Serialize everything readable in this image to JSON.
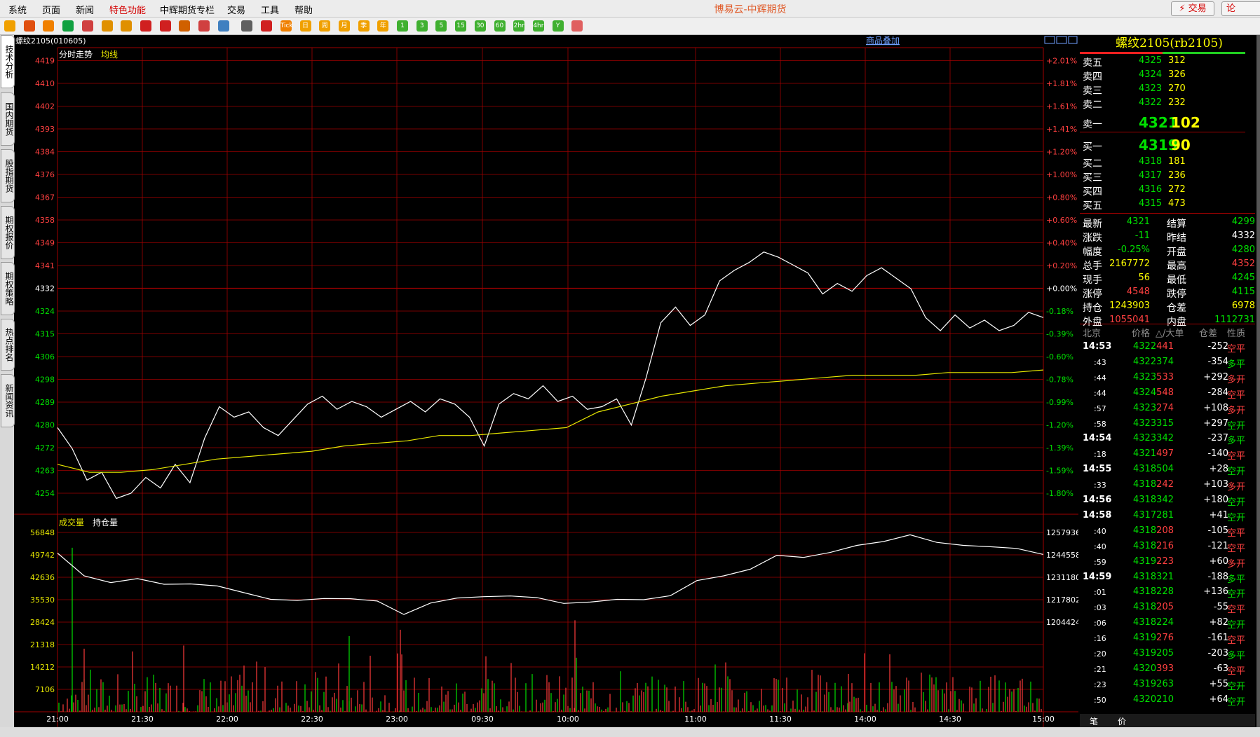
{
  "menubar": {
    "items": [
      "系统",
      "页面",
      "新闻",
      "特色功能",
      "中辉期货专栏",
      "交易",
      "工具",
      "帮助"
    ],
    "highlighted": "特色功能",
    "app_title": "博易云-中辉期货",
    "trade_button": "⚡ 交易",
    "forum_button": "论"
  },
  "toolbar": {
    "icons": [
      "back-icon",
      "home-icon",
      "folder-icon",
      "refresh-icon",
      "window-icon",
      "zoom-in-icon",
      "zoom-out-icon",
      "color-icon",
      "draw-icon",
      "brush-icon",
      "funnel-icon",
      "signal-icon",
      "table-icon",
      "chart-icon",
      "tick-icon",
      "day-icon",
      "week-icon",
      "month-icon",
      "quarter-icon",
      "year-icon",
      "min1-icon",
      "min3-icon",
      "min5-icon",
      "min15-icon",
      "min30-icon",
      "min60-icon",
      "min2h-icon",
      "min4h-icon",
      "custom-icon",
      "calculator-icon"
    ],
    "labels": [
      "",
      "",
      "",
      "",
      "",
      "",
      "",
      "",
      "",
      "",
      "",
      "",
      "",
      "",
      "Tick",
      "日",
      "周",
      "月",
      "季",
      "年",
      "1",
      "3",
      "5",
      "15",
      "30",
      "60",
      "2hr",
      "4hr",
      "Y",
      ""
    ]
  },
  "side_tabs": [
    "技术分析",
    "国内期货",
    "股指期货",
    "期权报价",
    "期权策略",
    "热点排名",
    "新闻资讯"
  ],
  "chart": {
    "contract_label": "螺纹2105(010605)",
    "overlay_button": "商品叠加",
    "price_panel_label": "分时走势",
    "avg_label": "均线",
    "volume_label": "成交量",
    "oi_label": "持仓量",
    "colors": {
      "grid": "#a00000",
      "price": "#ffffff",
      "avg": "#e6e600",
      "up": "#ff3b3b",
      "down": "#00e000",
      "label": "#ff4040",
      "neutral": "#ffffff"
    },
    "price_ticks": [
      "4419",
      "4410",
      "4402",
      "4393",
      "4384",
      "4376",
      "4367",
      "4358",
      "4349",
      "4341",
      "4332",
      "4324",
      "4315",
      "4306",
      "4298",
      "4289",
      "4280",
      "4272",
      "4263",
      "4254"
    ],
    "pct_ticks": [
      "+2.01%",
      "+1.81%",
      "+1.61%",
      "+1.41%",
      "+1.20%",
      "+1.00%",
      "+0.80%",
      "+0.60%",
      "+0.40%",
      "+0.20%",
      "+0.00%",
      "-0.18%",
      "-0.39%",
      "-0.60%",
      "-0.78%",
      "-0.99%",
      "-1.20%",
      "-1.39%",
      "-1.59%",
      "-1.80%"
    ],
    "volume_ticks": [
      "56848",
      "49742",
      "42636",
      "35530",
      "28424",
      "21318",
      "14212",
      "7106"
    ],
    "oi_ticks": [
      "1257936",
      "1244558",
      "1231180",
      "1217802",
      "1204424"
    ],
    "time_ticks": [
      "21:00",
      "21:30",
      "22:00",
      "22:30",
      "23:00",
      "09:30",
      "10:00",
      "11:00",
      "11:30",
      "14:00",
      "14:30",
      "15:00"
    ]
  },
  "chart_data": {
    "type": "line",
    "title": "螺纹2105",
    "price_range": [
      4254,
      4419
    ],
    "pre_settle": 4332,
    "series": [
      {
        "name": "分时走势",
        "values": [
          4279,
          4271,
          4259,
          4262,
          4252,
          4254,
          4260,
          4256,
          4265,
          4258,
          4275,
          4287,
          4283,
          4285,
          4279,
          4276,
          4282,
          4288,
          4291,
          4286,
          4289,
          4287,
          4283,
          4286,
          4289,
          4285,
          4290,
          4288,
          4283,
          4272,
          4288,
          4292,
          4290,
          4295,
          4289,
          4291,
          4286,
          4287,
          4290,
          4280,
          4298,
          4319,
          4325,
          4318,
          4322,
          4335,
          4339,
          4342,
          4346,
          4344,
          4341,
          4338,
          4330,
          4334,
          4331,
          4337,
          4340,
          4336,
          4332,
          4321,
          4316,
          4322,
          4317,
          4320,
          4316,
          4318,
          4323,
          4321
        ]
      },
      {
        "name": "均线",
        "values": [
          4265,
          4262,
          4262,
          4263,
          4265,
          4267,
          4268,
          4269,
          4270,
          4272,
          4273,
          4274,
          4276,
          4276,
          4277,
          4278,
          4279,
          4285,
          4288,
          4291,
          4293,
          4295,
          4296,
          4297,
          4298,
          4299,
          4299,
          4299,
          4300,
          4300,
          4300,
          4301
        ]
      }
    ],
    "oi_range": [
      1204424,
      1257936
    ],
    "oi_values": [
      1245600,
      1232000,
      1228000,
      1230400,
      1227000,
      1227200,
      1226000,
      1222000,
      1218000,
      1217400,
      1218500,
      1218400,
      1217000,
      1209000,
      1215800,
      1218800,
      1219600,
      1220000,
      1219000,
      1215600,
      1216400,
      1218000,
      1217800,
      1220200,
      1229200,
      1232000,
      1236000,
      1244300,
      1243000,
      1246000,
      1250200,
      1252500,
      1256500,
      1252000,
      1250200,
      1249400,
      1248400,
      1244800
    ],
    "volume_range": [
      0,
      56848
    ],
    "volume_note": "成交量 bars shown per minute, mixed red/green"
  },
  "quote": {
    "title": "螺纹2105(rb2105)",
    "asks": [
      {
        "label": "卖五",
        "price": "4325",
        "vol": "312"
      },
      {
        "label": "卖四",
        "price": "4324",
        "vol": "326"
      },
      {
        "label": "卖三",
        "price": "4323",
        "vol": "270"
      },
      {
        "label": "卖二",
        "price": "4322",
        "vol": "232"
      },
      {
        "label": "卖一",
        "price": "4321",
        "vol": "102"
      }
    ],
    "bids": [
      {
        "label": "买一",
        "price": "4319",
        "vol": "90"
      },
      {
        "label": "买二",
        "price": "4318",
        "vol": "181"
      },
      {
        "label": "买三",
        "price": "4317",
        "vol": "236"
      },
      {
        "label": "买四",
        "price": "4316",
        "vol": "272"
      },
      {
        "label": "买五",
        "price": "4315",
        "vol": "473"
      }
    ],
    "stats": [
      {
        "l1": "最新",
        "v1": "4321",
        "c1": "#00e000",
        "l2": "结算",
        "v2": "4299",
        "c2": "#00e000"
      },
      {
        "l1": "涨跌",
        "v1": "-11",
        "c1": "#00e000",
        "l2": "昨结",
        "v2": "4332",
        "c2": "#ffffff"
      },
      {
        "l1": "幅度",
        "v1": "-0.25%",
        "c1": "#00e000",
        "l2": "开盘",
        "v2": "4280",
        "c2": "#00e000"
      },
      {
        "l1": "总手",
        "v1": "2167772",
        "c1": "#ffff00",
        "l2": "最高",
        "v2": "4352",
        "c2": "#ff4040"
      },
      {
        "l1": "现手",
        "v1": "56",
        "c1": "#ffff00",
        "l2": "最低",
        "v2": "4245",
        "c2": "#00e000"
      },
      {
        "l1": "涨停",
        "v1": "4548",
        "c1": "#ff4040",
        "l2": "跌停",
        "v2": "4115",
        "c2": "#00e000"
      },
      {
        "l1": "持仓",
        "v1": "1243903",
        "c1": "#ffff00",
        "l2": "仓差",
        "v2": "6978",
        "c2": "#ffff00"
      },
      {
        "l1": "外盘",
        "v1": "1055041",
        "c1": "#ff4040",
        "l2": "内盘",
        "v2": "1112731",
        "c2": "#00e000"
      }
    ],
    "tick_header": [
      "北京",
      "价格",
      "△/大单",
      "仓差",
      "性质"
    ],
    "ticks": [
      {
        "t": "14:53",
        "p": "4322",
        "v": "441",
        "d": "-252",
        "n": "空平",
        "vc": "#ff4040",
        "nc": "#ff4040"
      },
      {
        "t": ":43",
        "p": "4322",
        "v": "374",
        "d": "-354",
        "n": "多平",
        "vc": "#00e000",
        "nc": "#00e000"
      },
      {
        "t": ":44",
        "p": "4323",
        "v": "533",
        "d": "+292",
        "n": "多开",
        "vc": "#ff4040",
        "nc": "#ff4040"
      },
      {
        "t": ":44",
        "p": "4324",
        "v": "548",
        "d": "-284",
        "n": "空平",
        "vc": "#ff4040",
        "nc": "#ff4040"
      },
      {
        "t": ":57",
        "p": "4323",
        "v": "274",
        "d": "+108",
        "n": "多开",
        "vc": "#ff4040",
        "nc": "#ff4040"
      },
      {
        "t": ":58",
        "p": "4323",
        "v": "315",
        "d": "+297",
        "n": "空开",
        "vc": "#00e000",
        "nc": "#00e000"
      },
      {
        "t": "14:54",
        "p": "4323",
        "v": "342",
        "d": "-237",
        "n": "多平",
        "vc": "#00e000",
        "nc": "#00e000"
      },
      {
        "t": ":18",
        "p": "4321",
        "v": "497",
        "d": "-140",
        "n": "空平",
        "vc": "#ff4040",
        "nc": "#ff4040"
      },
      {
        "t": "14:55",
        "p": "4318",
        "v": "504",
        "d": "+28",
        "n": "空开",
        "vc": "#00e000",
        "nc": "#00e000"
      },
      {
        "t": ":33",
        "p": "4318",
        "v": "242",
        "d": "+103",
        "n": "多开",
        "vc": "#ff4040",
        "nc": "#ff4040"
      },
      {
        "t": "14:56",
        "p": "4318",
        "v": "342",
        "d": "+180",
        "n": "空开",
        "vc": "#00e000",
        "nc": "#00e000"
      },
      {
        "t": "14:58",
        "p": "4317",
        "v": "281",
        "d": "+41",
        "n": "空开",
        "vc": "#00e000",
        "nc": "#00e000"
      },
      {
        "t": ":40",
        "p": "4318",
        "v": "208",
        "d": "-105",
        "n": "空平",
        "vc": "#ff4040",
        "nc": "#ff4040"
      },
      {
        "t": ":40",
        "p": "4318",
        "v": "216",
        "d": "-121",
        "n": "空平",
        "vc": "#ff4040",
        "nc": "#ff4040"
      },
      {
        "t": ":59",
        "p": "4319",
        "v": "223",
        "d": "+60",
        "n": "多开",
        "vc": "#ff4040",
        "nc": "#ff4040"
      },
      {
        "t": "14:59",
        "p": "4318",
        "v": "321",
        "d": "-188",
        "n": "多平",
        "vc": "#00e000",
        "nc": "#00e000"
      },
      {
        "t": ":01",
        "p": "4318",
        "v": "228",
        "d": "+136",
        "n": "空开",
        "vc": "#00e000",
        "nc": "#00e000"
      },
      {
        "t": ":03",
        "p": "4318",
        "v": "205",
        "d": "-55",
        "n": "空平",
        "vc": "#ff4040",
        "nc": "#ff4040"
      },
      {
        "t": ":06",
        "p": "4318",
        "v": "224",
        "d": "+82",
        "n": "空开",
        "vc": "#00e000",
        "nc": "#00e000"
      },
      {
        "t": ":16",
        "p": "4319",
        "v": "276",
        "d": "-161",
        "n": "空平",
        "vc": "#ff4040",
        "nc": "#ff4040"
      },
      {
        "t": ":20",
        "p": "4319",
        "v": "205",
        "d": "-203",
        "n": "多平",
        "vc": "#00e000",
        "nc": "#00e000"
      },
      {
        "t": ":21",
        "p": "4320",
        "v": "393",
        "d": "-63",
        "n": "空平",
        "vc": "#ff4040",
        "nc": "#ff4040"
      },
      {
        "t": ":23",
        "p": "4319",
        "v": "263",
        "d": "+55",
        "n": "空开",
        "vc": "#00e000",
        "nc": "#00e000"
      },
      {
        "t": ":50",
        "p": "4320",
        "v": "210",
        "d": "+64",
        "n": "空开",
        "vc": "#00e000",
        "nc": "#00e000"
      }
    ],
    "bottom_tabs": [
      "笔",
      "价"
    ]
  }
}
